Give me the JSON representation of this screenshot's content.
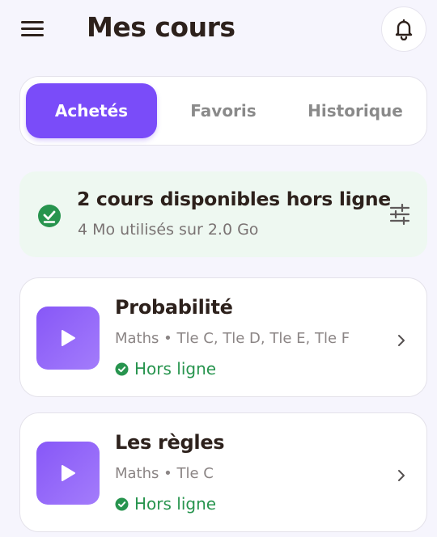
{
  "header": {
    "title": "Mes cours",
    "menu_icon": "hamburger-menu-icon",
    "bell_icon": "bell-icon"
  },
  "tabs": [
    {
      "label": "Achetés",
      "active": true
    },
    {
      "label": "Favoris",
      "active": false
    },
    {
      "label": "Historique",
      "active": false
    }
  ],
  "offline_banner": {
    "title": "2 cours disponibles hors ligne",
    "subtitle": "4 Mo utilisés sur 2.0 Go",
    "icon": "check-circle-icon",
    "settings_icon": "sliders-icon"
  },
  "courses": [
    {
      "title": "Probabilité",
      "meta": "Maths • Tle C, Tle D, Tle E, Tle F",
      "status": "Hors ligne"
    },
    {
      "title": "Les règles",
      "meta": "Maths • Tle C",
      "status": "Hors ligne"
    }
  ],
  "colors": {
    "accent": "#7a4cf9",
    "success": "#27944e",
    "background": "#f6f5fd",
    "banner_bg": "#eef8f1",
    "text": "#2d211c"
  }
}
